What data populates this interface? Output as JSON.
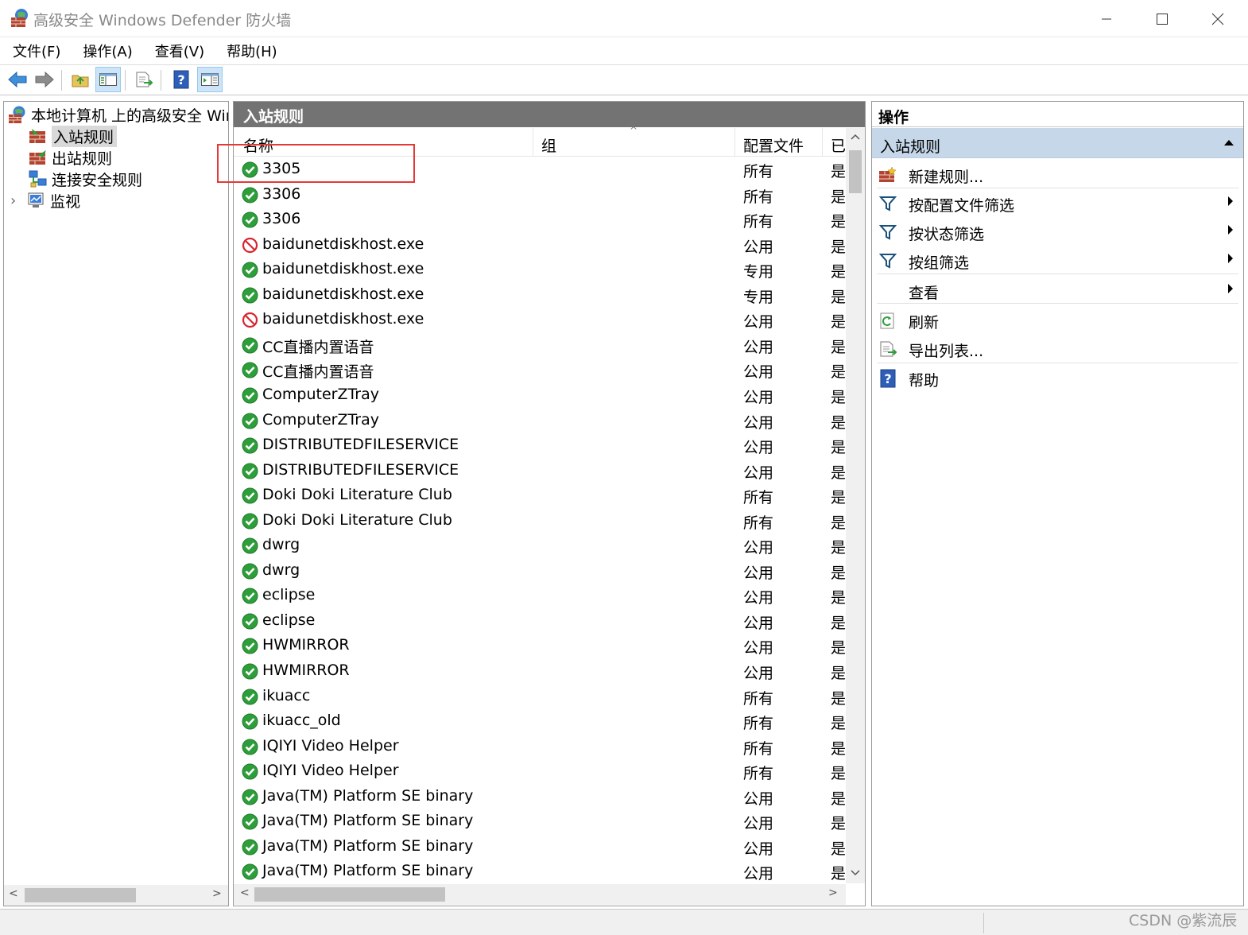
{
  "window": {
    "title": "高级安全 Windows Defender 防火墙",
    "controls": {
      "minimize": "—",
      "maximize": "☐",
      "close": "✕"
    }
  },
  "menu": [
    "文件(F)",
    "操作(A)",
    "查看(V)",
    "帮助(H)"
  ],
  "toolbar": {
    "buttons": [
      "back-icon",
      "forward-icon",
      "up-folder-icon",
      "show-hide-tree-icon",
      "export-list-icon",
      "help-icon",
      "show-hide-action-pane-icon"
    ]
  },
  "tree": {
    "root": "本地计算机 上的高级安全 Winc",
    "items": [
      "入站规则",
      "出站规则",
      "连接安全规则",
      "监视"
    ],
    "selected": "入站规则",
    "expander": "›"
  },
  "middle": {
    "title": "入站规则",
    "columns": [
      "名称",
      "组",
      "配置文件",
      "已"
    ],
    "sort_indicator": "^",
    "rows": [
      {
        "name": "3305",
        "profile": "所有",
        "enabled": "是",
        "status": "allow"
      },
      {
        "name": "3306",
        "profile": "所有",
        "enabled": "是",
        "status": "allow"
      },
      {
        "name": "3306",
        "profile": "所有",
        "enabled": "是",
        "status": "allow"
      },
      {
        "name": "baidunetdiskhost.exe",
        "profile": "公用",
        "enabled": "是",
        "status": "block"
      },
      {
        "name": "baidunetdiskhost.exe",
        "profile": "专用",
        "enabled": "是",
        "status": "allow"
      },
      {
        "name": "baidunetdiskhost.exe",
        "profile": "专用",
        "enabled": "是",
        "status": "allow"
      },
      {
        "name": "baidunetdiskhost.exe",
        "profile": "公用",
        "enabled": "是",
        "status": "block"
      },
      {
        "name": "CC直播内置语音",
        "profile": "公用",
        "enabled": "是",
        "status": "allow"
      },
      {
        "name": "CC直播内置语音",
        "profile": "公用",
        "enabled": "是",
        "status": "allow"
      },
      {
        "name": "ComputerZTray",
        "profile": "公用",
        "enabled": "是",
        "status": "allow"
      },
      {
        "name": "ComputerZTray",
        "profile": "公用",
        "enabled": "是",
        "status": "allow"
      },
      {
        "name": "DISTRIBUTEDFILESERVICE",
        "profile": "公用",
        "enabled": "是",
        "status": "allow"
      },
      {
        "name": "DISTRIBUTEDFILESERVICE",
        "profile": "公用",
        "enabled": "是",
        "status": "allow"
      },
      {
        "name": "Doki Doki Literature Club",
        "profile": "所有",
        "enabled": "是",
        "status": "allow"
      },
      {
        "name": "Doki Doki Literature Club",
        "profile": "所有",
        "enabled": "是",
        "status": "allow"
      },
      {
        "name": "dwrg",
        "profile": "公用",
        "enabled": "是",
        "status": "allow"
      },
      {
        "name": "dwrg",
        "profile": "公用",
        "enabled": "是",
        "status": "allow"
      },
      {
        "name": "eclipse",
        "profile": "公用",
        "enabled": "是",
        "status": "allow"
      },
      {
        "name": "eclipse",
        "profile": "公用",
        "enabled": "是",
        "status": "allow"
      },
      {
        "name": "HWMIRROR",
        "profile": "公用",
        "enabled": "是",
        "status": "allow"
      },
      {
        "name": "HWMIRROR",
        "profile": "公用",
        "enabled": "是",
        "status": "allow"
      },
      {
        "name": "ikuacc",
        "profile": "所有",
        "enabled": "是",
        "status": "allow"
      },
      {
        "name": "ikuacc_old",
        "profile": "所有",
        "enabled": "是",
        "status": "allow"
      },
      {
        "name": "IQIYI Video Helper",
        "profile": "所有",
        "enabled": "是",
        "status": "allow"
      },
      {
        "name": "IQIYI Video Helper",
        "profile": "所有",
        "enabled": "是",
        "status": "allow"
      },
      {
        "name": "Java(TM) Platform SE binary",
        "profile": "公用",
        "enabled": "是",
        "status": "allow"
      },
      {
        "name": "Java(TM) Platform SE binary",
        "profile": "公用",
        "enabled": "是",
        "status": "allow"
      },
      {
        "name": "Java(TM) Platform SE binary",
        "profile": "公用",
        "enabled": "是",
        "status": "allow"
      },
      {
        "name": "Java(TM) Platform SE binary",
        "profile": "公用",
        "enabled": "是",
        "status": "allow"
      }
    ]
  },
  "actions": {
    "title": "操作",
    "section": "入站规则",
    "items": [
      {
        "label": "新建规则...",
        "icon": "new-rule-icon",
        "submenu": false
      },
      {
        "label": "按配置文件筛选",
        "icon": "filter-icon",
        "submenu": true
      },
      {
        "label": "按状态筛选",
        "icon": "filter-icon",
        "submenu": true
      },
      {
        "label": "按组筛选",
        "icon": "filter-icon",
        "submenu": true
      },
      {
        "label": "查看",
        "icon": "",
        "submenu": true
      },
      {
        "label": "刷新",
        "icon": "refresh-icon",
        "submenu": false
      },
      {
        "label": "导出列表...",
        "icon": "export-list-icon",
        "submenu": false
      },
      {
        "label": "帮助",
        "icon": "help-icon",
        "submenu": false
      }
    ]
  },
  "watermark": "CSDN @紫流辰",
  "colors": {
    "allow": "#2e9e3a",
    "block": "#d9232d",
    "header_bg": "#737373",
    "section_bg": "#c5d7e9",
    "annotation": "#e53935"
  }
}
